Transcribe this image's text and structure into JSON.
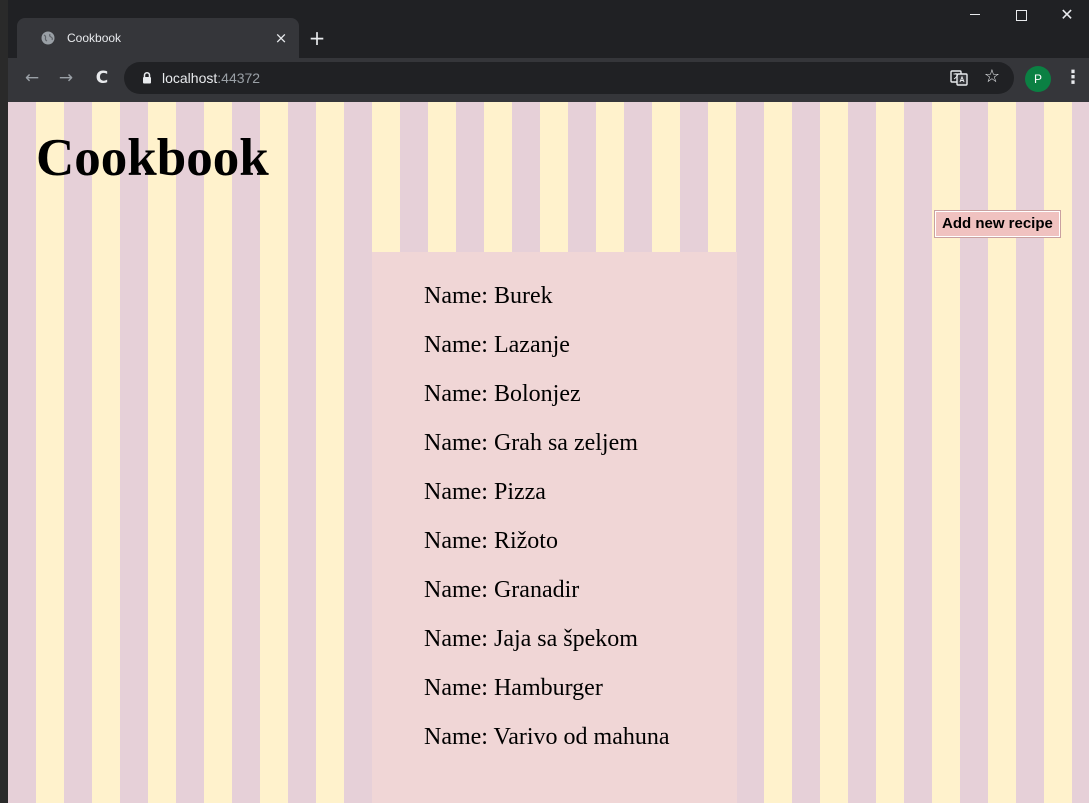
{
  "browser": {
    "tab_title": "Cookbook",
    "tab_close": "×",
    "new_tab": "+",
    "url_host": "localhost",
    "url_port": ":44372",
    "avatar_letter": "P",
    "back": "←",
    "forward": "→",
    "reload": "C",
    "bookmark": "☆",
    "menu": "⋮",
    "close_window": "✕"
  },
  "page": {
    "title": "Cookbook",
    "add_button_label": "Add new recipe",
    "recipe_prefix": "Name: ",
    "recipes": [
      "Burek",
      "Lazanje",
      "Bolonjez",
      "Grah sa zeljem",
      "Pizza",
      "Rižoto",
      "Granadir",
      "Jaja sa špekom",
      "Hamburger",
      "Varivo od mahuna"
    ]
  },
  "colors": {
    "stripe_pink": "#e6d0d8",
    "stripe_cream": "#fff2cc",
    "panel_bg": "#f0d6d6",
    "button_bg": "#f0c2c0",
    "avatar_bg": "#0b8043",
    "chrome_dark": "#202124",
    "chrome_mid": "#35363a"
  }
}
